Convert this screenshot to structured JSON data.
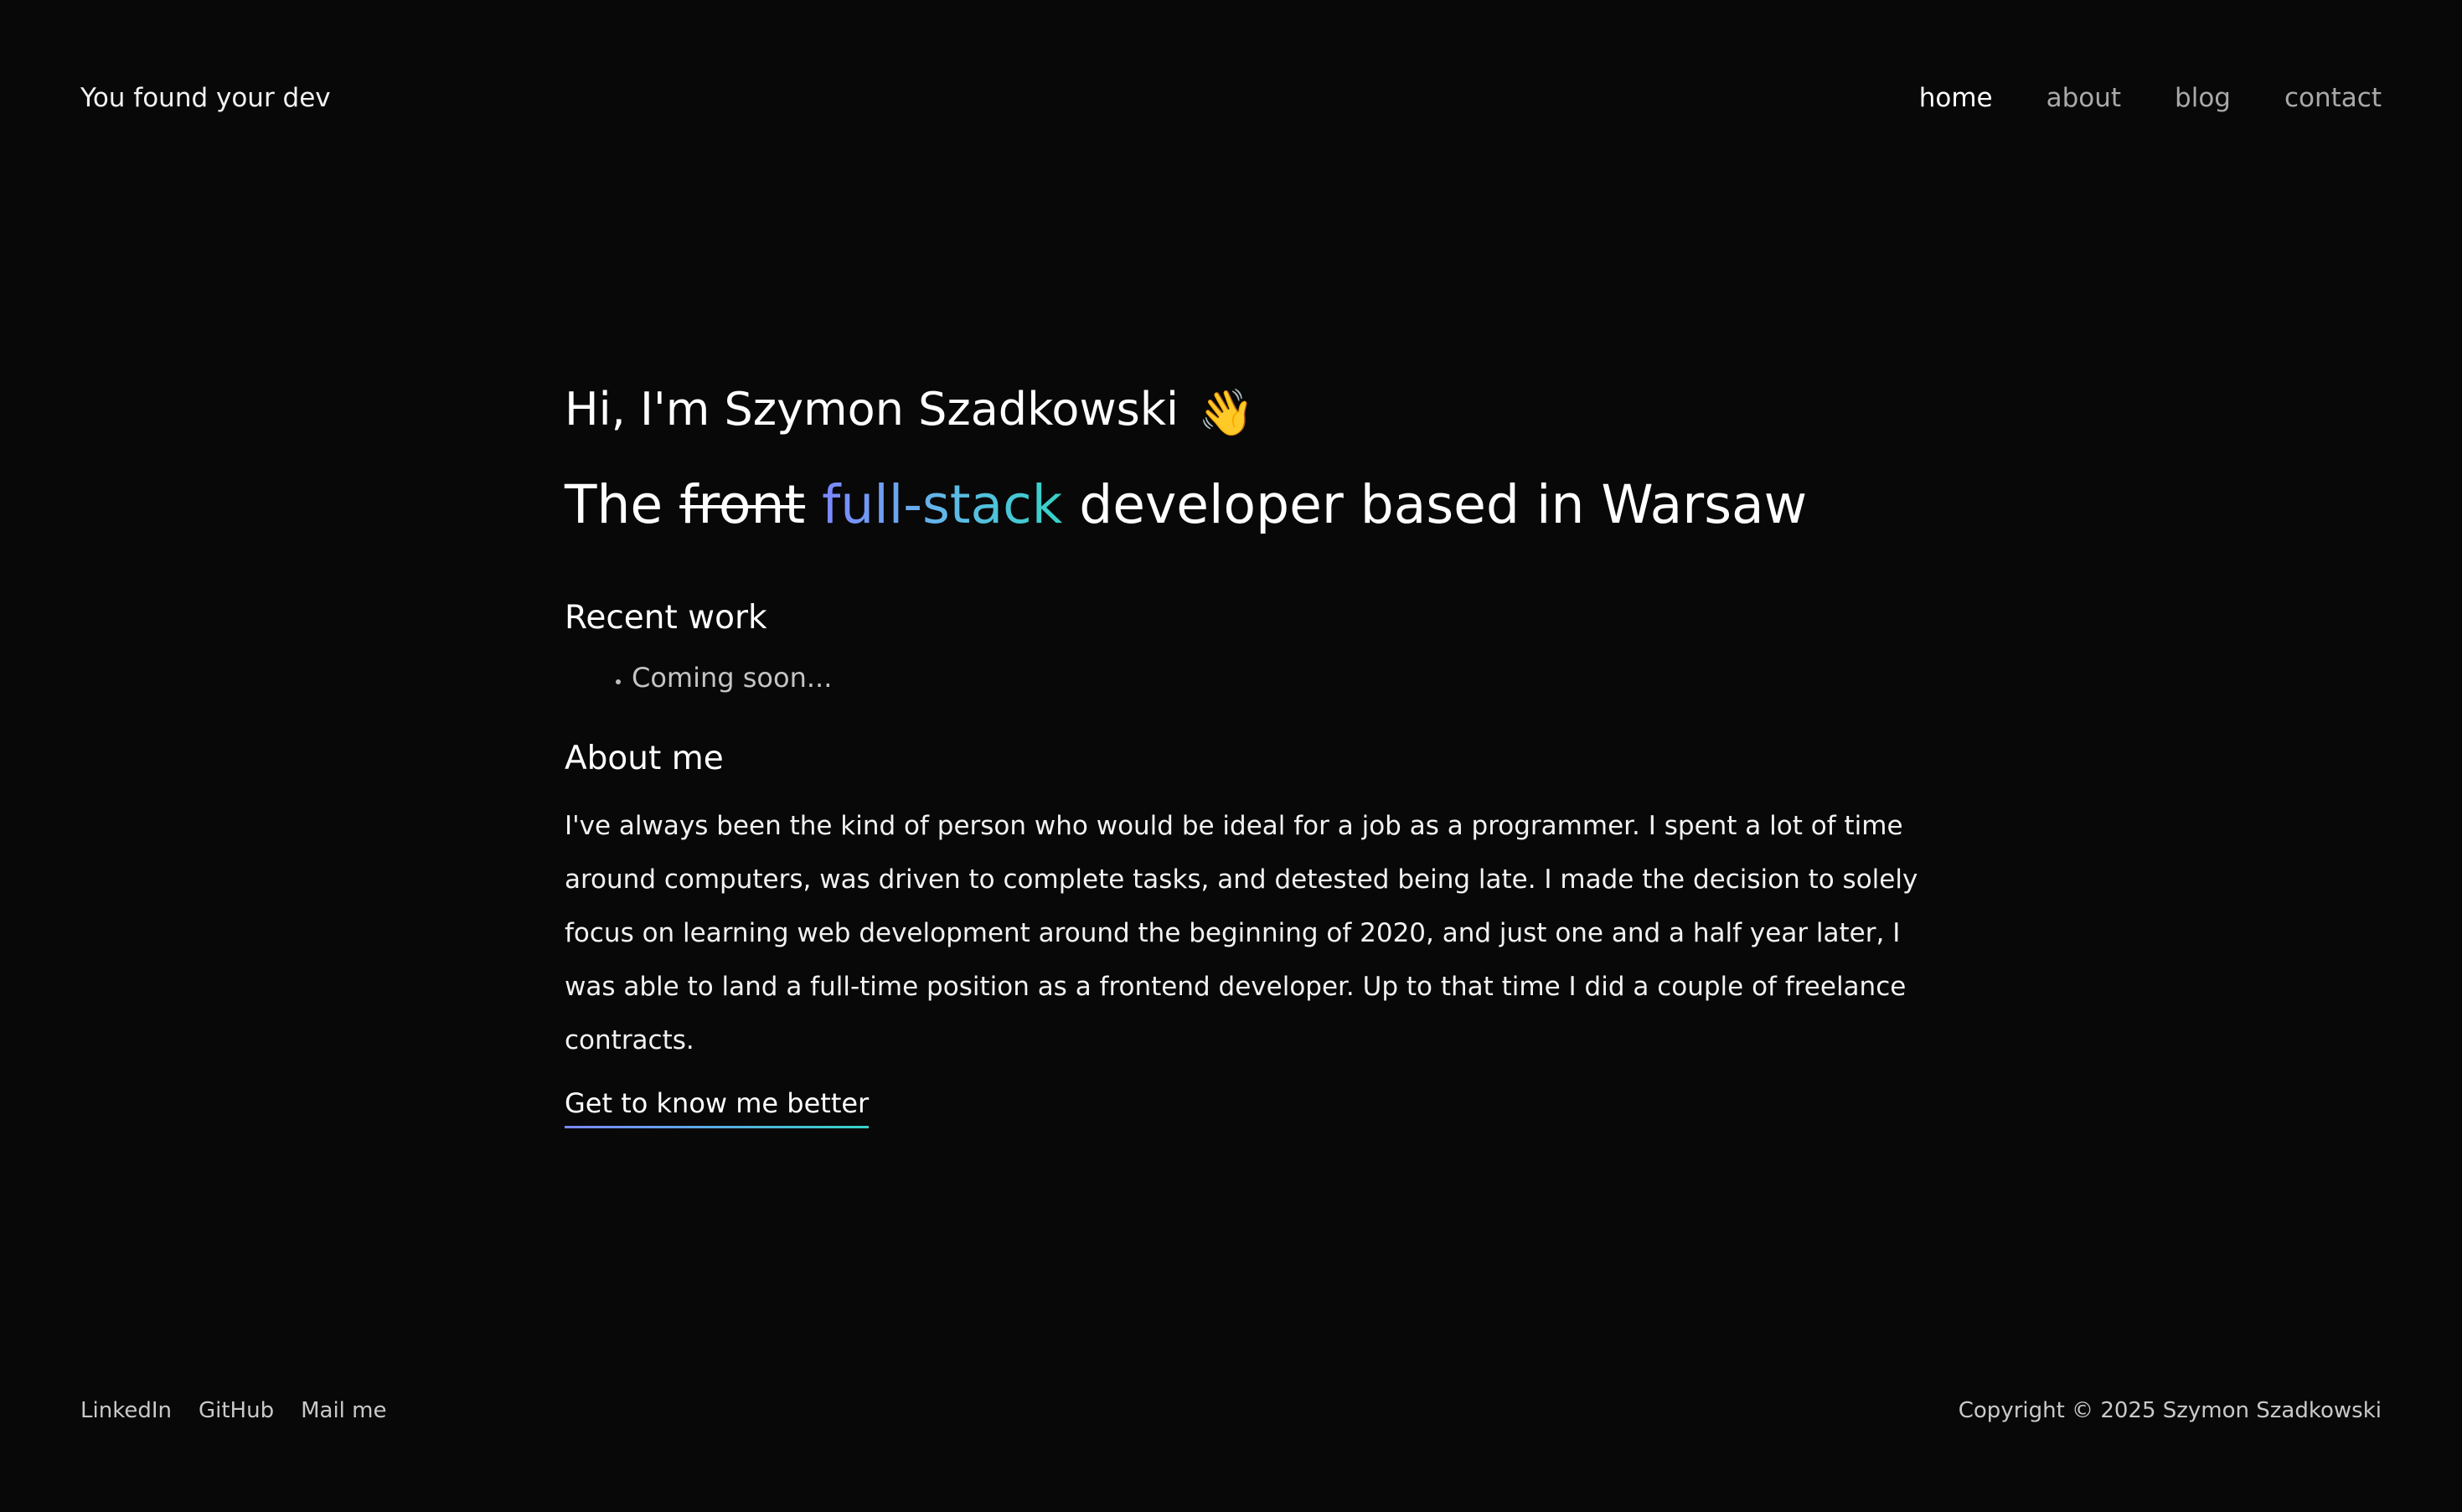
{
  "header": {
    "brand": "You found your dev",
    "nav": [
      {
        "label": "home",
        "active": true
      },
      {
        "label": "about",
        "active": false
      },
      {
        "label": "blog",
        "active": false
      },
      {
        "label": "contact",
        "active": false
      }
    ]
  },
  "hero": {
    "greeting": "Hi, I'm Szymon Szadkowski",
    "greeting_emoji": "👋",
    "tagline_prefix": "The",
    "tagline_struck": "front",
    "tagline_highlight": "full-stack",
    "tagline_suffix": "developer based in Warsaw"
  },
  "recent_work": {
    "title": "Recent work",
    "items": [
      "Coming soon..."
    ]
  },
  "about": {
    "title": "About me",
    "text": "I've always been the kind of person who would be ideal for a job as a programmer. I spent a lot of time around computers, was driven to complete tasks, and detested being late. I made the decision to solely focus on learning web development around the beginning of 2020, and just one and a half year later, I was able to land a full-time position as a frontend developer. Up to that time I did a couple of freelance contracts.",
    "link_label": "Get to know me better"
  },
  "footer": {
    "links": [
      "LinkedIn",
      "GitHub",
      "Mail me"
    ],
    "copyright": "Copyright © 2025 Szymon Szadkowski"
  },
  "colors": {
    "background": "#080808",
    "gradient_start": "#7c87ff",
    "gradient_end": "#34d3c7"
  }
}
